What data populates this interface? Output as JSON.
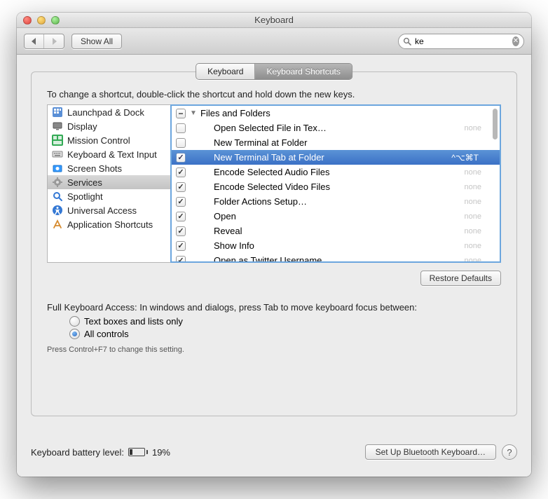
{
  "window": {
    "title": "Keyboard"
  },
  "toolbar": {
    "show_all": "Show All",
    "search_value": "ke"
  },
  "tabs": {
    "keyboard": "Keyboard",
    "shortcuts": "Keyboard Shortcuts"
  },
  "instruction": "To change a shortcut, double-click the shortcut and hold down the new keys.",
  "sidebar": {
    "items": [
      {
        "label": "Launchpad & Dock",
        "icon": "launchpad"
      },
      {
        "label": "Display",
        "icon": "display"
      },
      {
        "label": "Mission Control",
        "icon": "mission"
      },
      {
        "label": "Keyboard & Text Input",
        "icon": "keyboard"
      },
      {
        "label": "Screen Shots",
        "icon": "screenshot"
      },
      {
        "label": "Services",
        "icon": "gear",
        "selected": true
      },
      {
        "label": "Spotlight",
        "icon": "spotlight"
      },
      {
        "label": "Universal Access",
        "icon": "access"
      },
      {
        "label": "Application Shortcuts",
        "icon": "app"
      }
    ]
  },
  "shortcuts": {
    "group_label": "Files and Folders",
    "items": [
      {
        "label": "Open Selected File in Tex…",
        "checked": false,
        "shortcut": "",
        "none": "none"
      },
      {
        "label": "New Terminal at Folder",
        "checked": false,
        "shortcut": "",
        "none": ""
      },
      {
        "label": "New Terminal Tab at Folder",
        "checked": true,
        "shortcut": "^⌥⌘T",
        "selected": true
      },
      {
        "label": "Encode Selected Audio Files",
        "checked": true,
        "shortcut": "",
        "none": "none"
      },
      {
        "label": "Encode Selected Video Files",
        "checked": true,
        "shortcut": "",
        "none": "none"
      },
      {
        "label": "Folder Actions Setup…",
        "checked": true,
        "shortcut": "",
        "none": "none"
      },
      {
        "label": "Open",
        "checked": true,
        "shortcut": "",
        "none": "none"
      },
      {
        "label": "Reveal",
        "checked": true,
        "shortcut": "",
        "none": "none"
      },
      {
        "label": "Show Info",
        "checked": true,
        "shortcut": "",
        "none": "none"
      },
      {
        "label": "Open as Twitter Username",
        "checked": true,
        "shortcut": "",
        "none": "none"
      }
    ]
  },
  "buttons": {
    "restore": "Restore Defaults",
    "bluetooth": "Set Up Bluetooth Keyboard…"
  },
  "fka": {
    "label": "Full Keyboard Access: In windows and dialogs, press Tab to move keyboard focus between:",
    "opt1": "Text boxes and lists only",
    "opt2": "All controls",
    "hint": "Press Control+F7 to change this setting."
  },
  "battery": {
    "label": "Keyboard battery level:",
    "percent": "19%"
  }
}
